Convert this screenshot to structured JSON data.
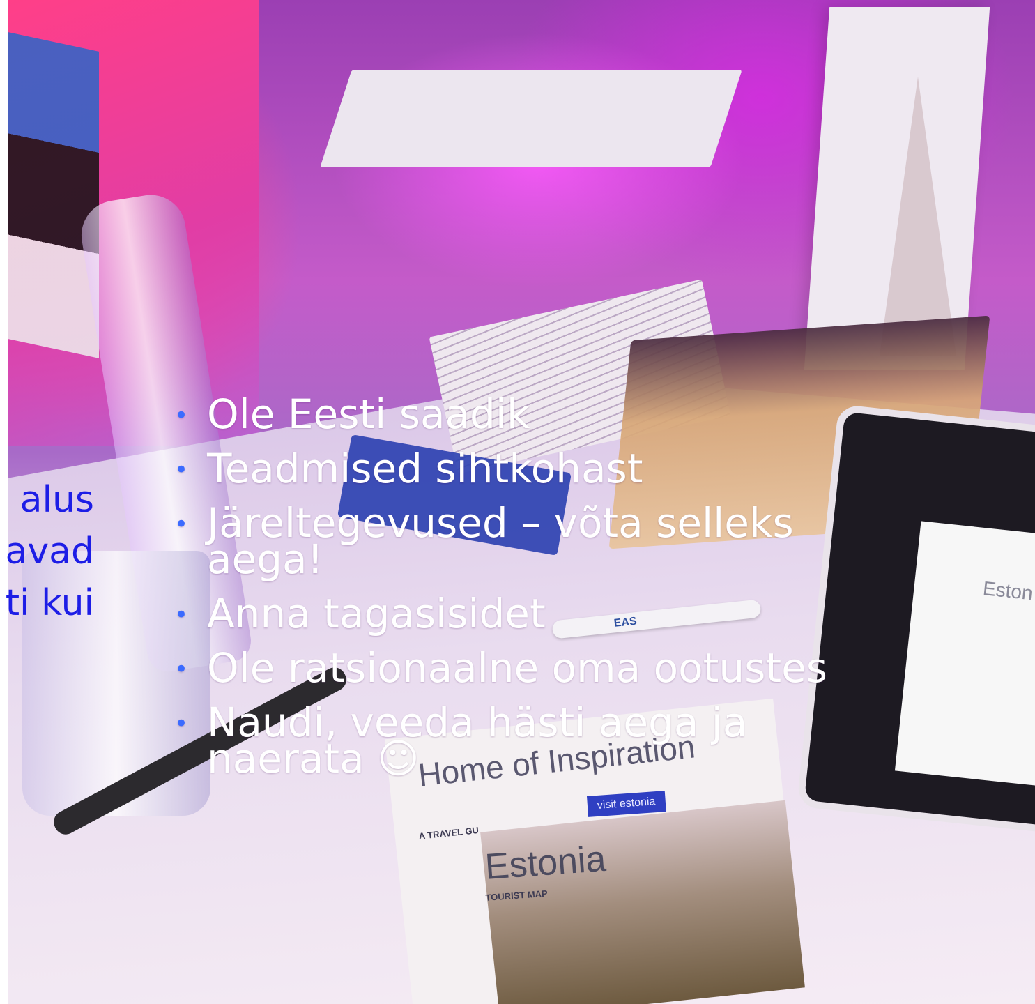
{
  "slide": {
    "bullets": [
      "Ole Eesti saadik",
      "Teadmised sihtkohast",
      "Järeltegevused – võta selleks aega!",
      "Anna tagasisidet",
      "Ole ratsionaalne oma ootustes",
      "Naudi, veeda hästi aega ja naerata ☺"
    ],
    "bullet_color": "#3b6bff",
    "text_color": "#ffffff",
    "left_fragments": [
      "alus",
      "avad",
      "ti kui"
    ],
    "fragment_color": "#1d1de6"
  },
  "photo": {
    "map_booklet_title": "Home of Inspiration",
    "map_booklet_subtitle": "A TRAVEL GU",
    "brand_badge": "visit estonia",
    "map_title": "Estonia",
    "map_subtitle": "TOURIST MAP",
    "pen_logo": "EAS",
    "tablet_screen_text": "Eston"
  }
}
